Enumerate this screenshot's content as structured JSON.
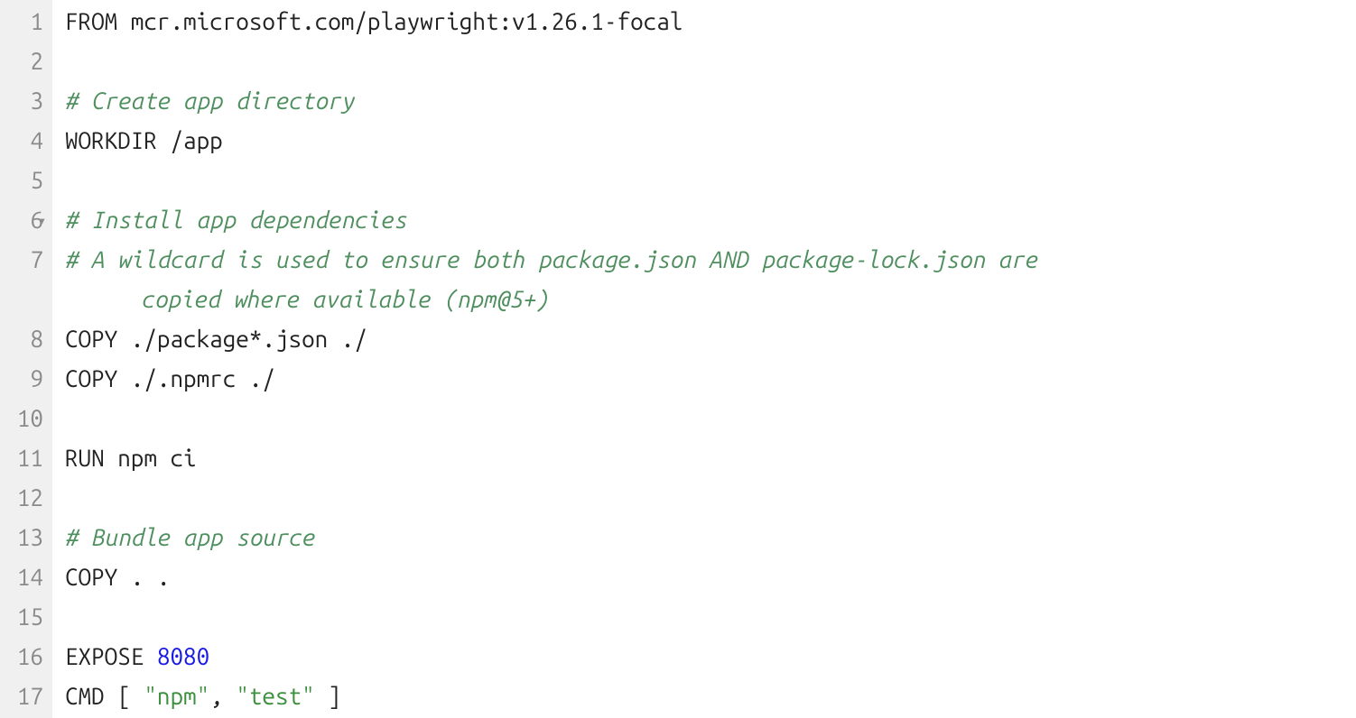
{
  "gutter": {
    "numbers": [
      "1",
      "2",
      "3",
      "4",
      "5",
      "6",
      "7",
      "",
      "8",
      "9",
      "10",
      "11",
      "12",
      "13",
      "14",
      "15",
      "16",
      "17"
    ],
    "fold_marker_on_visual_row": 5
  },
  "lines": [
    {
      "tokens": [
        {
          "cls": "tok-keyword",
          "text": "FROM"
        },
        {
          "cls": "tok-plain",
          "text": " mcr.microsoft.com/playwright:v1.26.1-focal"
        }
      ]
    },
    {
      "tokens": [
        {
          "cls": "tok-plain",
          "text": ""
        }
      ]
    },
    {
      "tokens": [
        {
          "cls": "tok-comment",
          "text": "# Create app directory"
        }
      ]
    },
    {
      "tokens": [
        {
          "cls": "tok-keyword",
          "text": "WORKDIR"
        },
        {
          "cls": "tok-plain",
          "text": " /app"
        }
      ]
    },
    {
      "tokens": [
        {
          "cls": "tok-plain",
          "text": ""
        }
      ]
    },
    {
      "tokens": [
        {
          "cls": "tok-comment",
          "text": "# Install app dependencies"
        }
      ]
    },
    {
      "tokens": [
        {
          "cls": "tok-comment",
          "text": "# A wildcard is used to ensure both package.json AND package-lock.json are"
        }
      ]
    },
    {
      "tokens": [
        {
          "cls": "tok-comment",
          "text": " copied where available (npm@5+)"
        }
      ],
      "wrapped": true
    },
    {
      "tokens": [
        {
          "cls": "tok-keyword",
          "text": "COPY"
        },
        {
          "cls": "tok-plain",
          "text": " ./package*.json ./"
        }
      ]
    },
    {
      "tokens": [
        {
          "cls": "tok-keyword",
          "text": "COPY"
        },
        {
          "cls": "tok-plain",
          "text": " ./.npmrc ./"
        }
      ]
    },
    {
      "tokens": [
        {
          "cls": "tok-plain",
          "text": ""
        }
      ]
    },
    {
      "tokens": [
        {
          "cls": "tok-keyword",
          "text": "RUN"
        },
        {
          "cls": "tok-plain",
          "text": " npm ci"
        }
      ]
    },
    {
      "tokens": [
        {
          "cls": "tok-plain",
          "text": ""
        }
      ]
    },
    {
      "tokens": [
        {
          "cls": "tok-comment",
          "text": "# Bundle app source"
        }
      ]
    },
    {
      "tokens": [
        {
          "cls": "tok-keyword",
          "text": "COPY"
        },
        {
          "cls": "tok-plain",
          "text": " . ."
        }
      ]
    },
    {
      "tokens": [
        {
          "cls": "tok-plain",
          "text": ""
        }
      ]
    },
    {
      "tokens": [
        {
          "cls": "tok-keyword",
          "text": "EXPOSE"
        },
        {
          "cls": "tok-plain",
          "text": " "
        },
        {
          "cls": "tok-number",
          "text": "8080"
        }
      ]
    },
    {
      "tokens": [
        {
          "cls": "tok-keyword",
          "text": "CMD"
        },
        {
          "cls": "tok-plain",
          "text": " [ "
        },
        {
          "cls": "tok-string",
          "text": "\"npm\""
        },
        {
          "cls": "tok-plain",
          "text": ", "
        },
        {
          "cls": "tok-string",
          "text": "\"test\""
        },
        {
          "cls": "tok-plain",
          "text": " ]"
        }
      ]
    }
  ]
}
